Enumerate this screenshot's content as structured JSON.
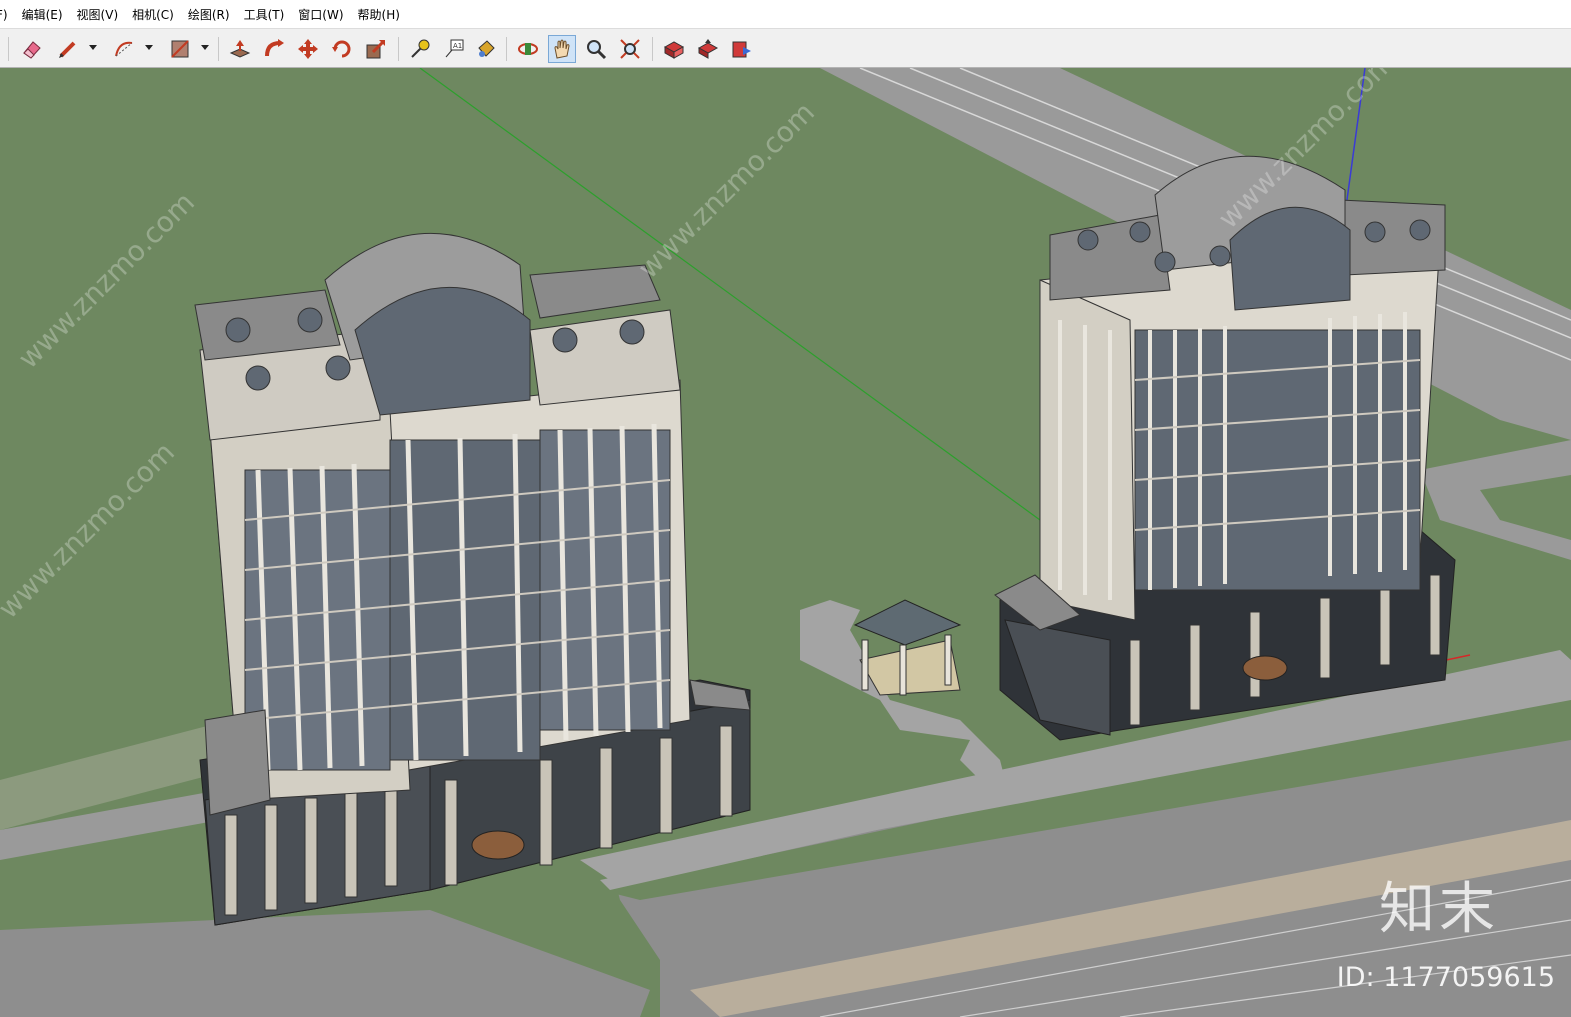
{
  "menubar": {
    "items": [
      "F)",
      "编辑(E)",
      "视图(V)",
      "相机(C)",
      "绘图(R)",
      "工具(T)",
      "窗口(W)",
      "帮助(H)"
    ]
  },
  "toolbar": {
    "tools": [
      "eraser-icon",
      "pencil-icon",
      "arc-icon",
      "rectangle-icon",
      "push-pull-icon",
      "follow-me-icon",
      "move-icon",
      "rotate-icon",
      "scale-icon",
      "tape-measure-icon",
      "text-icon",
      "paint-bucket-icon",
      "orbit-icon",
      "pan-icon",
      "zoom-icon",
      "zoom-extents-icon",
      "warehouse-icon",
      "share-model-icon",
      "extension-icon"
    ],
    "active_tool": "pan-icon"
  },
  "viewport": {
    "watermark_text": "www.znzmo.com",
    "logo_text": "知末",
    "id_text": "ID: 1177059615"
  },
  "colors": {
    "grass": "#6e8860",
    "road": "#8e8e8e",
    "building": "#d8d5cc",
    "glass": "#6b7480",
    "roof": "#8a8a8a",
    "axis_green": "#2ca02c",
    "axis_blue": "#3a3ad6",
    "axis_red": "#d62828"
  }
}
